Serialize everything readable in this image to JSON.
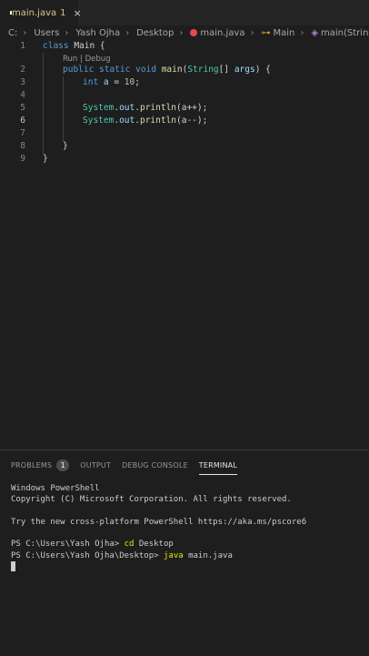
{
  "tab": {
    "file_name": "main.java",
    "problem_count": "1",
    "close_glyph": "×"
  },
  "breadcrumb": {
    "drive": "C:",
    "users": "Users",
    "user": "Yash Ojha",
    "folder": "Desktop",
    "file": "main.java",
    "class": "Main",
    "method": "main(String[])"
  },
  "editor": {
    "line_numbers": [
      "1",
      "2",
      "3",
      "4",
      "5",
      "6",
      "7",
      "8",
      "9"
    ],
    "active_line": "6",
    "codelens": "Run | Debug",
    "lines": {
      "l1_kw": "class",
      "l1_name": " Main {",
      "l2_kw1": "public",
      "l2_kw2": " static",
      "l2_kw3": " void",
      "l2_fn": " main",
      "l2_p1": "(",
      "l2_ty": "String",
      "l2_p2": "[] ",
      "l2_var": "args",
      "l2_p3": ") {",
      "l3_kw": "int",
      "l3_var": " a",
      "l3_eq": " = ",
      "l3_num": "10",
      "l3_end": ";",
      "l5_obj": "System",
      "l5_dot1": ".",
      "l5_out": "out",
      "l5_dot2": ".",
      "l5_fn": "println",
      "l5_arg": "(a++);",
      "l6_obj": "System",
      "l6_dot1": ".",
      "l6_out": "out",
      "l6_dot2": ".",
      "l6_fn": "println",
      "l6_arg": "(a--);",
      "l8": "}",
      "l9": "}"
    }
  },
  "panel": {
    "tabs": [
      "PROBLEMS",
      "OUTPUT",
      "DEBUG CONSOLE",
      "TERMINAL"
    ],
    "problems_badge": "1",
    "active_tab": "TERMINAL"
  },
  "terminal": {
    "line1": "Windows PowerShell",
    "line2": "Copyright (C) Microsoft Corporation. All rights reserved.",
    "line3": "Try the new cross-platform PowerShell https://aka.ms/pscore6",
    "prompt1": "PS C:\\Users\\Yash Ojha> ",
    "cmd1": "cd",
    "arg1": " Desktop",
    "prompt2": "PS C:\\Users\\Yash Ojha\\Desktop> ",
    "cmd2": "java",
    "arg2": " main.java"
  },
  "colors": {
    "accent": "#e7e7e7",
    "error": "#e8484f",
    "modified_tab": "#e2c08d"
  }
}
